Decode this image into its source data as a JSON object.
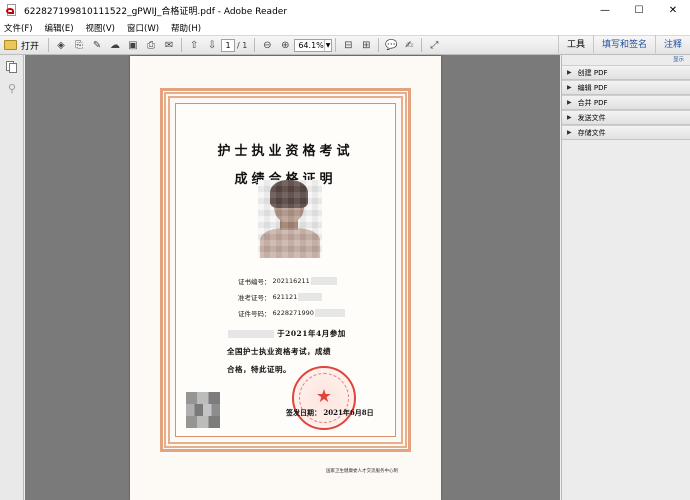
{
  "window": {
    "title": "622827199810111522_gPWIJ_合格证明.pdf - Adobe Reader",
    "controls": {
      "minimize": "—",
      "maximize": "☐",
      "close": "✕"
    }
  },
  "menu": [
    "文件(F)",
    "编辑(E)",
    "视图(V)",
    "窗口(W)",
    "帮助(H)"
  ],
  "toolbar": {
    "open_label": "打开",
    "page_current": "1",
    "page_total": "/ 1",
    "zoom": "64.1%",
    "right_tabs": [
      "工具",
      "填写和签名",
      "注释"
    ]
  },
  "right_panel": {
    "top_link": "显示",
    "items": [
      "创建 PDF",
      "编辑 PDF",
      "合并 PDF",
      "发送文件",
      "存储文件"
    ]
  },
  "certificate": {
    "title_line1": "护士执业资格考试",
    "title_line2": "成绩合格证明",
    "cert_no_label": "证书编号：",
    "cert_no_value": "202116211",
    "exam_no_label": "准考证号：",
    "exam_no_value": "621121",
    "id_no_label": "证件号码：",
    "id_no_value": "6228271990",
    "body_line1": "于2021年4月参加",
    "body_line2": "全国护士执业资格考试，成绩",
    "body_line3": "合格，特此证明。",
    "issue_date": "签发日期：  2021年6月8日",
    "footer": "国家卫生健康委人才交流服务中心制",
    "seal_star": "★"
  }
}
